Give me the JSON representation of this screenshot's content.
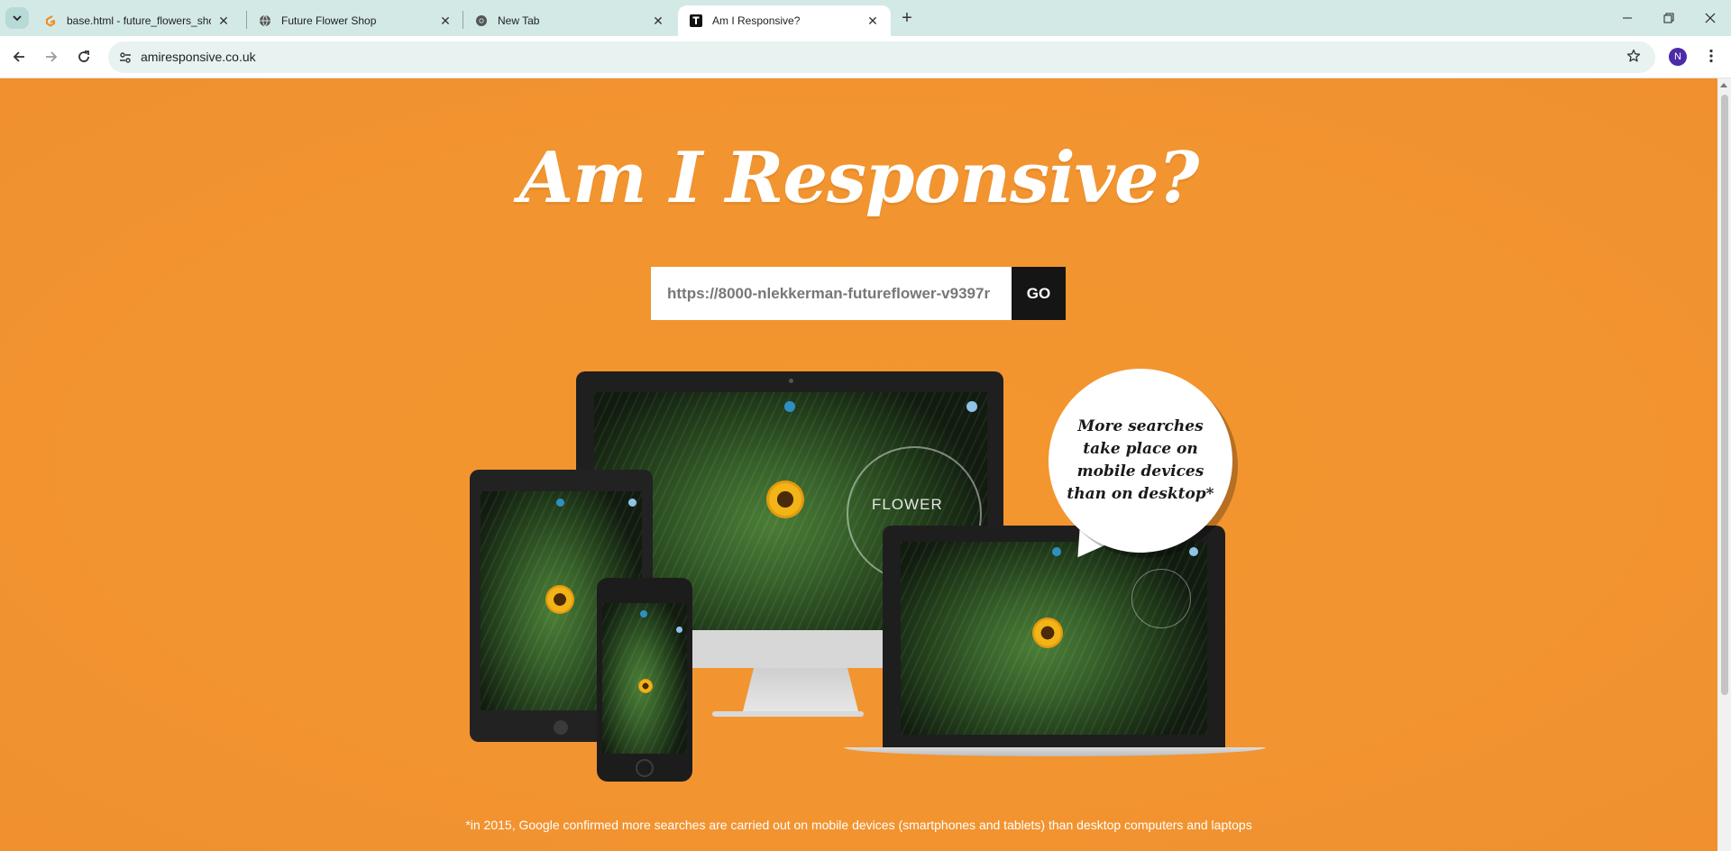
{
  "browser": {
    "tabs": [
      {
        "title": "base.html - future_flowers_shop",
        "icon": "gitpod-icon",
        "active": false
      },
      {
        "title": "Future Flower Shop",
        "icon": "globe-icon",
        "active": false
      },
      {
        "title": "New Tab",
        "icon": "chrome-icon",
        "active": false
      },
      {
        "title": "Am I Responsive?",
        "icon": "responsive-t-icon",
        "active": true
      }
    ],
    "address": "amiresponsive.co.uk",
    "profile_initial": "N"
  },
  "page": {
    "title": "Am I Responsive?",
    "url_input_value": "https://8000-nlekkerman-futureflower-v9397r",
    "go_label": "GO",
    "bubble_text": "More searches take place on mobile devices than on desktop*",
    "screen_brand": "FLOWER",
    "footnote": "*in 2015, Google confirmed more searches are carried out on mobile devices (smartphones and tablets) than desktop computers and laptops"
  },
  "colors": {
    "page_bg": "#f39430",
    "button_bg": "#151515",
    "tab_strip": "#d3e9e6"
  }
}
